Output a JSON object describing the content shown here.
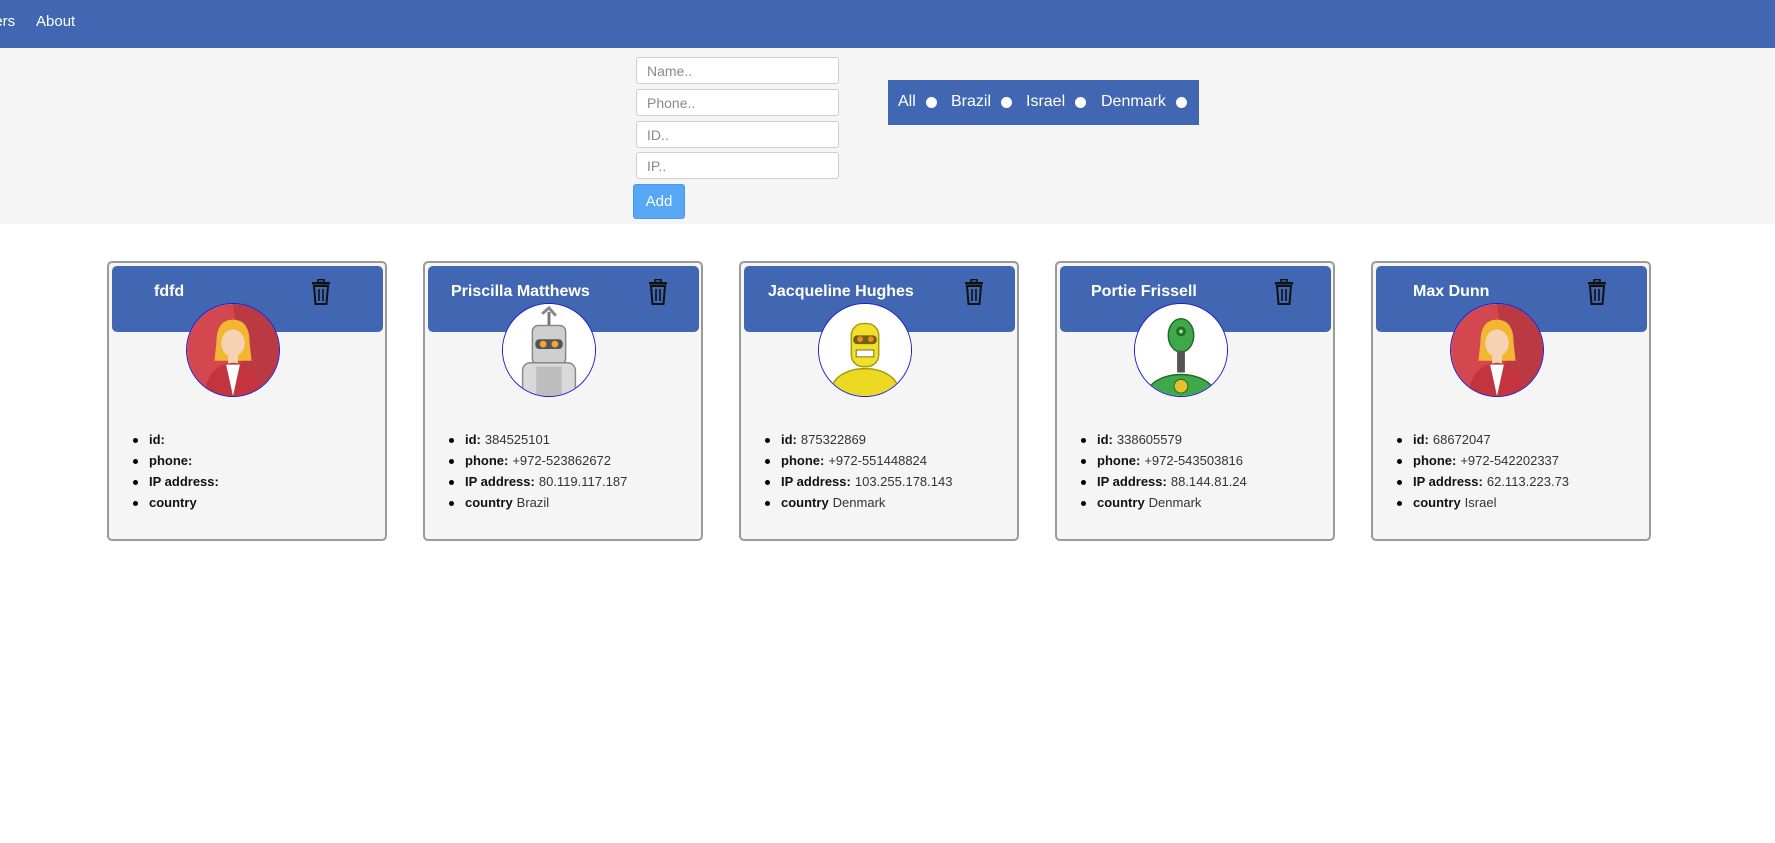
{
  "nav": {
    "items": [
      {
        "label": "Users"
      },
      {
        "label": "About"
      }
    ]
  },
  "form": {
    "name_placeholder": "Name..",
    "phone_placeholder": "Phone..",
    "id_placeholder": "ID..",
    "ip_placeholder": "IP..",
    "add_label": "Add"
  },
  "filter": {
    "options": [
      {
        "label": "All"
      },
      {
        "label": "Brazil"
      },
      {
        "label": "Israel"
      },
      {
        "label": "Denmark"
      }
    ]
  },
  "field_labels": {
    "id": "id:",
    "phone": "phone:",
    "ip": "IP address:",
    "country": "country"
  },
  "users": [
    {
      "name": "fdfd",
      "avatar": "woman-avatar",
      "id": "",
      "phone": "",
      "ip": "",
      "country": ""
    },
    {
      "name": "Priscilla Matthews",
      "avatar": "white-robot-avatar",
      "id": "384525101",
      "phone": "+972-523862672",
      "ip": "80.119.117.187",
      "country": "Brazil"
    },
    {
      "name": "Jacqueline Hughes",
      "avatar": "yellow-robot-avatar",
      "id": "875322869",
      "phone": "+972-551448824",
      "ip": "103.255.178.143",
      "country": "Denmark"
    },
    {
      "name": "Portie Frissell",
      "avatar": "green-robot-avatar",
      "id": "338605579",
      "phone": "+972-543503816",
      "ip": "88.144.81.24",
      "country": "Denmark"
    },
    {
      "name": "Max Dunn",
      "avatar": "woman-avatar",
      "id": "68672047",
      "phone": "+972-542202337",
      "ip": "62.113.223.73",
      "country": "Israel"
    }
  ],
  "colors": {
    "nav": "#4267b2",
    "accent_button": "#56a8f5",
    "avatar_border": "#1a1ad6"
  }
}
